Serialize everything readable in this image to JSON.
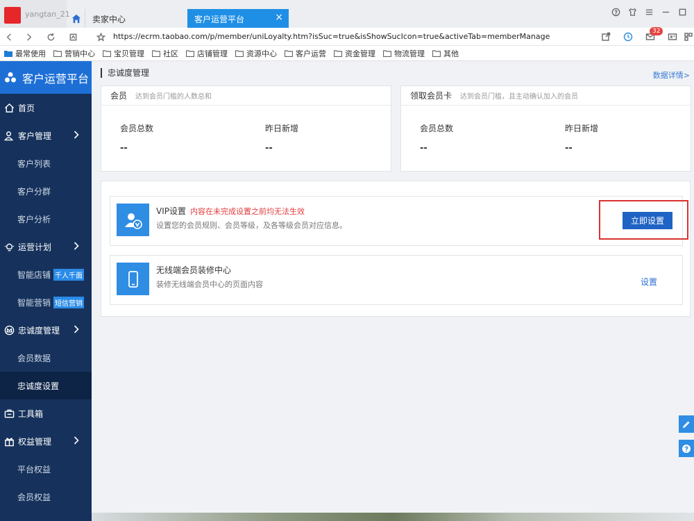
{
  "browser": {
    "user_name": "yangtan_21",
    "tabs": [
      {
        "label": "卖家中心"
      },
      {
        "label": "客户运营平台"
      }
    ],
    "close_glyph": "×",
    "url": "https://ecrm.taobao.com/p/member/uniLoyalty.htm?isSuc=true&isShowSucIcon=true&activeTab=memberManage",
    "message_count": "32"
  },
  "bookmarks": [
    {
      "label": "最常使用"
    },
    {
      "label": "营销中心"
    },
    {
      "label": "宝贝管理"
    },
    {
      "label": "社区"
    },
    {
      "label": "店铺管理"
    },
    {
      "label": "资源中心"
    },
    {
      "label": "客户运营"
    },
    {
      "label": "资金管理"
    },
    {
      "label": "物流管理"
    },
    {
      "label": "其他"
    }
  ],
  "sidebar": {
    "brand": "客户运营平台",
    "items": [
      {
        "label": "首页"
      },
      {
        "label": "客户管理"
      },
      {
        "label": "客户列表"
      },
      {
        "label": "客户分群"
      },
      {
        "label": "客户分析"
      },
      {
        "label": "运营计划"
      },
      {
        "label": "智能店铺",
        "tag": "千人千面"
      },
      {
        "label": "智能营销",
        "tag": "短信营销"
      },
      {
        "label": "忠诚度管理"
      },
      {
        "label": "会员数据"
      },
      {
        "label": "忠诚度设置"
      },
      {
        "label": "工具箱"
      },
      {
        "label": "权益管理"
      },
      {
        "label": "平台权益"
      },
      {
        "label": "会员权益"
      }
    ]
  },
  "main": {
    "page_title": "忠诚度管理",
    "details_link": "数据详情>",
    "cards": [
      {
        "title": "会员",
        "subtitle": "达到会员门槛的人数总和",
        "stats": [
          {
            "label": "会员总数",
            "value": "--"
          },
          {
            "label": "昨日新增",
            "value": "--"
          }
        ]
      },
      {
        "title": "领取会员卡",
        "subtitle": "达到会员门槛，且主动确认加入的会员",
        "stats": [
          {
            "label": "会员总数",
            "value": "--"
          },
          {
            "label": "昨日新增",
            "value": "--"
          }
        ]
      }
    ],
    "settings": [
      {
        "title": "VIP设置",
        "warning": "内容在未完成设置之前均无法生效",
        "desc": "设置您的会员规则、会员等级，及各等级会员对应信息。",
        "action": "立即设置"
      },
      {
        "title": "无线端会员装修中心",
        "desc": "装修无线端会员中心的页面内容",
        "action": "设置"
      }
    ]
  },
  "colors": {
    "sidebar_bg": "#16325c",
    "brand_bg": "#1d6fd6",
    "primary_button": "#1f63c4",
    "warning_text": "#e33b3b",
    "highlight_box": "#d9322f"
  }
}
